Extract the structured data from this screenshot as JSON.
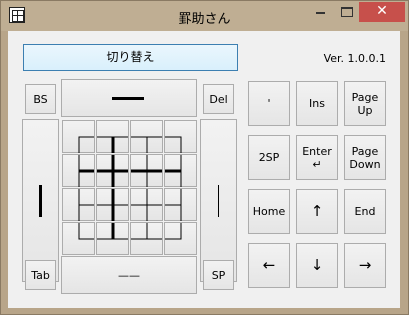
{
  "window": {
    "title": "罫助さん",
    "close_glyph": "✕"
  },
  "header": {
    "toggle_label": "切り替え",
    "version": "Ver. 1.0.0.1"
  },
  "left": {
    "bs": "BS",
    "del": "Del",
    "tab": "Tab",
    "sp": "SP",
    "h_line": "——"
  },
  "right": {
    "quote": "'",
    "ins": "Ins",
    "page_up": "Page\nUp",
    "sp2": "2SP",
    "enter": "Enter\n↵",
    "page_down": "Page\nDown",
    "home": "Home",
    "up": "↑",
    "end": "End",
    "left": "←",
    "down": "↓",
    "right": "→"
  }
}
